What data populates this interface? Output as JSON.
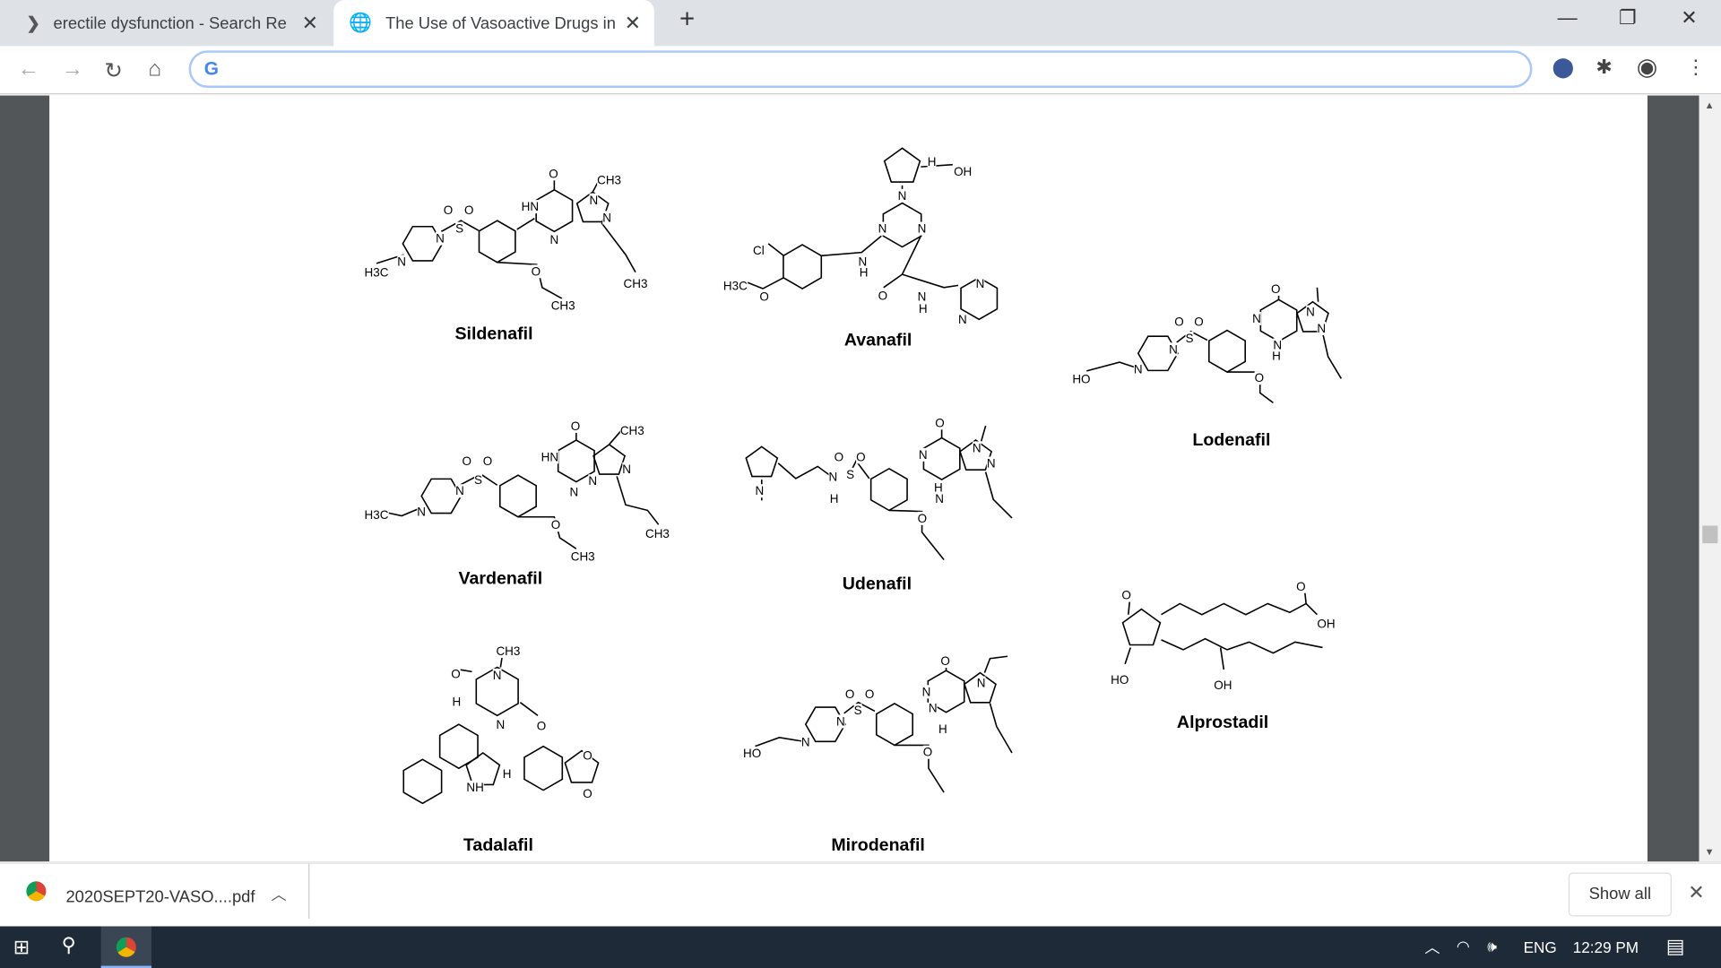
{
  "tabs": [
    {
      "label": "erectile dysfunction - Search Results",
      "icon": "bing-icon"
    },
    {
      "label": "The Use of Vasoactive Drugs in the",
      "icon": "globe-icon",
      "active": true
    }
  ],
  "address": {
    "value": ""
  },
  "molecules": [
    {
      "name": "Sildenafil",
      "labels": [
        "H3C",
        "N",
        "N",
        "S",
        "O",
        "O",
        "HN",
        "O",
        "N",
        "CH3",
        "N",
        "N",
        "O",
        "CH3",
        "CH3"
      ]
    },
    {
      "name": "Avanafil",
      "labels": [
        "H",
        "OH",
        "N",
        "N",
        "N",
        "Cl",
        "N",
        "H",
        "H3C",
        "O",
        "O",
        "N",
        "H",
        "N",
        "N"
      ]
    },
    {
      "name": "Lodenafil",
      "labels": [
        "HO",
        "N",
        "N",
        "S",
        "O",
        "O",
        "N",
        "O",
        "N",
        "N",
        "H",
        "N",
        "O"
      ]
    },
    {
      "name": "Vardenafil",
      "labels": [
        "H3C",
        "N",
        "N",
        "S",
        "O",
        "O",
        "HN",
        "O",
        "CH3",
        "N",
        "N",
        "N",
        "O",
        "CH3",
        "CH3"
      ]
    },
    {
      "name": "Udenafil",
      "labels": [
        "N",
        "N",
        "H",
        "S",
        "O",
        "O",
        "N",
        "O",
        "N",
        "N",
        "H",
        "N",
        "O"
      ]
    },
    {
      "name": "Alprostadil",
      "labels": [
        "O",
        "O",
        "OH",
        "HO",
        "OH"
      ]
    },
    {
      "name": "Tadalafil",
      "labels": [
        "CH3",
        "N",
        "O",
        "H",
        "N",
        "O",
        "NH",
        "H",
        "O",
        "O"
      ]
    },
    {
      "name": "Mirodenafil",
      "labels": [
        "HO",
        "N",
        "N",
        "S",
        "O",
        "O",
        "N",
        "O",
        "N",
        "N",
        "H",
        "O"
      ]
    }
  ],
  "download": {
    "file": "2020SEPT20-VASO....pdf",
    "show_all": "Show all"
  },
  "taskbar": {
    "lang": "ENG",
    "time": "12:29 PM"
  }
}
